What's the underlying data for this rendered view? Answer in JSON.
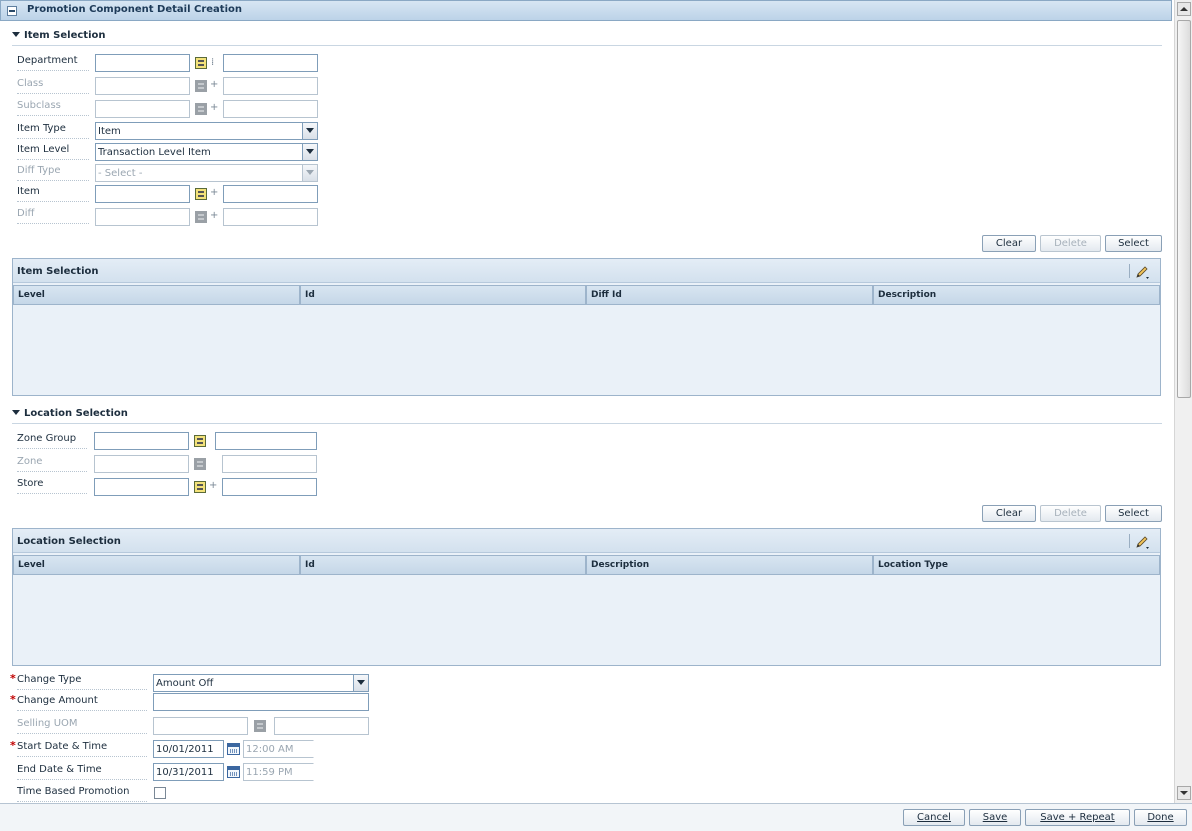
{
  "page": {
    "title": "Promotion Component Detail Creation"
  },
  "item_selection": {
    "section_title": "Item Selection",
    "fields": {
      "department": {
        "label": "Department",
        "value": "",
        "desc": ""
      },
      "class": {
        "label": "Class",
        "value": "",
        "desc": ""
      },
      "subclass": {
        "label": "Subclass",
        "value": "",
        "desc": ""
      },
      "item_type": {
        "label": "Item Type",
        "value": "Item"
      },
      "item_level": {
        "label": "Item Level",
        "value": "Transaction Level Item"
      },
      "diff_type": {
        "label": "Diff Type",
        "value": "- Select -"
      },
      "item": {
        "label": "Item",
        "value": "",
        "desc": ""
      },
      "diff": {
        "label": "Diff",
        "value": "",
        "desc": ""
      }
    },
    "buttons": {
      "clear": "Clear",
      "delete": "Delete",
      "select": "Select"
    },
    "table": {
      "title": "Item Selection",
      "columns": [
        "Level",
        "Id",
        "Diff Id",
        "Description"
      ],
      "rows": []
    }
  },
  "location_selection": {
    "section_title": "Location Selection",
    "fields": {
      "zone_group": {
        "label": "Zone Group",
        "value": "",
        "desc": ""
      },
      "zone": {
        "label": "Zone",
        "value": "",
        "desc": ""
      },
      "store": {
        "label": "Store",
        "value": "",
        "desc": ""
      }
    },
    "buttons": {
      "clear": "Clear",
      "delete": "Delete",
      "select": "Select"
    },
    "table": {
      "title": "Location Selection",
      "columns": [
        "Level",
        "Id",
        "Description",
        "Location Type"
      ],
      "rows": []
    }
  },
  "change": {
    "change_type": {
      "label": "Change Type",
      "value": "Amount Off"
    },
    "change_amount": {
      "label": "Change Amount",
      "value": ""
    },
    "selling_uom": {
      "label": "Selling UOM",
      "value": "",
      "desc": ""
    },
    "start": {
      "label": "Start Date & Time",
      "date": "10/01/2011",
      "time": "12:00 AM"
    },
    "end": {
      "label": "End Date & Time",
      "date": "10/31/2011",
      "time": "11:59 PM"
    },
    "time_based": {
      "label": "Time Based Promotion"
    }
  },
  "footer": {
    "cancel": "Cancel",
    "save": "Save",
    "save_repeat": "Save + Repeat",
    "done": "Done"
  }
}
